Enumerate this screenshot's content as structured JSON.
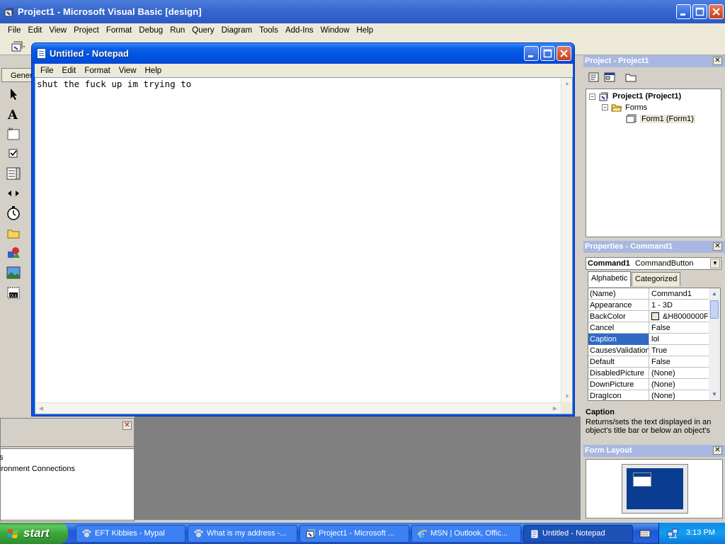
{
  "vb": {
    "title": "Project1 - Microsoft Visual Basic [design]",
    "menu": [
      "File",
      "Edit",
      "View",
      "Project",
      "Format",
      "Debug",
      "Run",
      "Query",
      "Diagram",
      "Tools",
      "Add-Ins",
      "Window",
      "Help"
    ],
    "toolbox_label": "Gener"
  },
  "notepad": {
    "title": "Untitled - Notepad",
    "menu": [
      "File",
      "Edit",
      "Format",
      "View",
      "Help"
    ],
    "text": "shut the fuck up im trying to"
  },
  "project_panel": {
    "title": "Project - Project1",
    "close": "✕",
    "tree": {
      "root": "Project1 (Project1)",
      "folder": "Forms",
      "form": "Form1 (Form1)"
    }
  },
  "properties_panel": {
    "title": "Properties - Command1",
    "close": "✕",
    "object": "Command1",
    "object_type": "CommandButton",
    "tabs": [
      "Alphabetic",
      "Categorized"
    ],
    "rows": [
      {
        "name": "(Name)",
        "value": "Command1"
      },
      {
        "name": "Appearance",
        "value": "1 - 3D"
      },
      {
        "name": "BackColor",
        "value": "&H8000000F"
      },
      {
        "name": "Cancel",
        "value": "False"
      },
      {
        "name": "Caption",
        "value": "lol"
      },
      {
        "name": "CausesValidation",
        "value": "True"
      },
      {
        "name": "Default",
        "value": "False"
      },
      {
        "name": "DisabledPicture",
        "value": "(None)"
      },
      {
        "name": "DownPicture",
        "value": "(None)"
      },
      {
        "name": "DragIcon",
        "value": "(None)"
      }
    ],
    "selected_row": "Caption",
    "description_title": "Caption",
    "description_text": "Returns/sets the text displayed in an object's title bar or below an object's"
  },
  "layout_panel": {
    "title": "Form Layout",
    "close": "✕"
  },
  "data_view": {
    "close": "✕",
    "lines": [
      "s",
      "ironment Connections"
    ]
  },
  "taskbar": {
    "start": "start",
    "tasks": [
      {
        "label": "EFT Kibbies - Mypal",
        "icon": "paw-icon"
      },
      {
        "label": "What is my address -...",
        "icon": "paw-icon"
      },
      {
        "label": "Project1 - Microsoft ...",
        "icon": "vb-icon"
      },
      {
        "label": "MSN | Outlook, Offic...",
        "icon": "ie-icon"
      },
      {
        "label": "Untitled - Notepad",
        "icon": "notepad-icon"
      }
    ],
    "active_task": "Untitled - Notepad",
    "clock": "3:13 PM"
  },
  "colors": {
    "xp_blue": "#0054e3",
    "start_green": "#3aa83a",
    "selection": "#316ac5",
    "mdi_gray": "#808080"
  }
}
